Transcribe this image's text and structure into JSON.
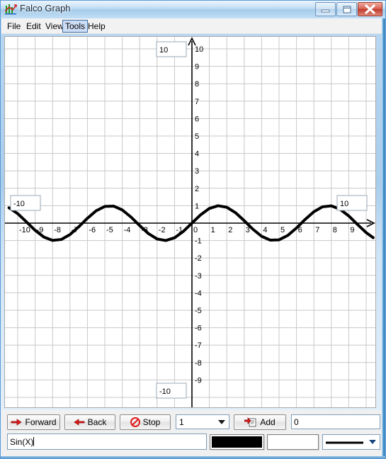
{
  "window": {
    "title": "Falco Graph",
    "icon": "graph-icon",
    "buttons": {
      "minimize": "minimize-icon",
      "maximize": "maximize-icon",
      "close": "close-icon"
    }
  },
  "menu": {
    "items": [
      {
        "label": "File",
        "selected": false
      },
      {
        "label": "Edit",
        "selected": false
      },
      {
        "label": "View",
        "selected": false
      },
      {
        "label": "Tools",
        "selected": true
      },
      {
        "label": "Help",
        "selected": false
      }
    ]
  },
  "graph": {
    "range_boxes": {
      "top": "10",
      "bottom": "-10",
      "left": "-10",
      "right": "10"
    },
    "x_tick_labels": [
      "-10",
      "-9",
      "-8",
      "-7",
      "-6",
      "-5",
      "-4",
      "-3",
      "-2",
      "-1",
      "0",
      "1",
      "2",
      "3",
      "4",
      "5",
      "6",
      "7",
      "8",
      "9"
    ],
    "y_tick_labels": [
      "10",
      "9",
      "8",
      "7",
      "6",
      "5",
      "4",
      "3",
      "2",
      "1",
      "-1",
      "-2",
      "-3",
      "-4",
      "-5",
      "-6",
      "-7",
      "-8",
      "-9"
    ],
    "grid_color": "#c8c8c8",
    "axis_color": "#000000",
    "curve_color": "#000000",
    "background": "#ffffff"
  },
  "chart_data": {
    "type": "line",
    "title": "",
    "xlabel": "",
    "ylabel": "",
    "expression": "Sin(X)",
    "xlim": [
      -10.55,
      10.4
    ],
    "ylim": [
      -10.55,
      10.55
    ],
    "grid": true,
    "legend": false,
    "series": [
      {
        "name": "Sin(X)",
        "color": "#000000",
        "line_width": 4,
        "amplitude": 1,
        "period": 6.2832,
        "formula": "y = sin(x)",
        "x": [
          -10.5,
          -10,
          -9.5,
          -9,
          -8.5,
          -8,
          -7.5,
          -7,
          -6.5,
          -6,
          -5.5,
          -5,
          -4.5,
          -4,
          -3.5,
          -3,
          -2.5,
          -2,
          -1.5,
          -1,
          -0.5,
          0,
          0.5,
          1,
          1.5,
          2,
          2.5,
          3,
          3.5,
          4,
          4.5,
          5,
          5.5,
          6,
          6.5,
          7,
          7.5,
          8,
          8.5,
          9,
          9.5,
          10,
          10.4
        ],
        "y": [
          0.8797,
          0.544,
          0.0752,
          -0.4121,
          -0.7985,
          -0.9894,
          -0.938,
          -0.657,
          -0.2151,
          0.2794,
          0.7055,
          0.9589,
          0.9775,
          0.7568,
          0.3508,
          -0.1411,
          -0.5985,
          -0.9093,
          -0.9975,
          -0.8415,
          -0.4794,
          0.0,
          0.4794,
          0.8415,
          0.9975,
          0.9093,
          0.5985,
          0.1411,
          -0.3508,
          -0.7568,
          -0.9775,
          -0.9589,
          -0.7055,
          -0.2794,
          0.2151,
          0.657,
          0.938,
          0.9894,
          0.7985,
          0.4121,
          -0.0752,
          -0.544,
          -0.8352
        ]
      }
    ]
  },
  "toolbar": {
    "forward_label": "Forward",
    "forward_icon": "arrow-right-icon",
    "back_label": "Back",
    "back_icon": "arrow-left-icon",
    "stop_label": "Stop",
    "stop_icon": "stop-circle-icon",
    "step_combo_value": "1",
    "step_combo_icon": "chevron-down-icon",
    "add_label": "Add",
    "add_icon": "add-document-icon",
    "value_field": "0"
  },
  "expression_bar": {
    "expression_value": "Sin(X)",
    "expression_placeholder": "",
    "line_color": "#000000",
    "fill_color": "#ffffff",
    "line_style_icon": "solid-line-icon",
    "line_style_arrow": "chevron-down-icon"
  }
}
